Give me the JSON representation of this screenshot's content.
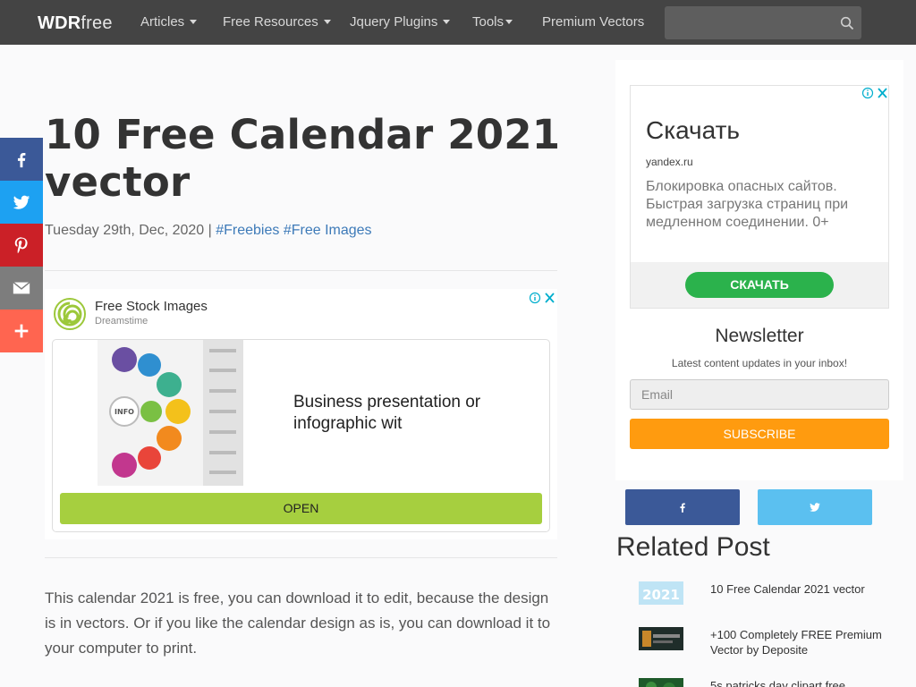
{
  "nav": {
    "logo_bold": "WDR",
    "logo_light": "free",
    "items": [
      {
        "label": "Articles"
      },
      {
        "label": "Free Resources"
      },
      {
        "label": "Jquery Plugins"
      },
      {
        "label": "Tools"
      },
      {
        "label": "Premium Vectors"
      }
    ],
    "search_placeholder": ""
  },
  "share_bar": [
    {
      "icon": "facebook-icon",
      "color": "#3b5998"
    },
    {
      "icon": "twitter-icon",
      "color": "#1da1f2"
    },
    {
      "icon": "pinterest-icon",
      "color": "#cb2027"
    },
    {
      "icon": "email-icon",
      "color": "#7d7d7d"
    },
    {
      "icon": "plus-icon",
      "color": "#ff6550"
    }
  ],
  "article": {
    "title": "10 Free Calendar 2021 vector",
    "date": "Tuesday 29th, Dec, 2020",
    "separator": " | ",
    "tags": [
      "#Freebies",
      "#Free Images"
    ],
    "body": "This calendar 2021 is free, you can download it to edit, because the design is in vectors. Or if you like the calendar design as is, you can download it to your computer to print."
  },
  "ad_main": {
    "advertiser": "Free Stock Images",
    "sub": "Dreamstime",
    "text": "Business presentation or infographic wit",
    "button": "OPEN",
    "image_label": "INFO"
  },
  "ad_side": {
    "headline": "Скачать",
    "domain": "yandex.ru",
    "description": "Блокировка опасных сайтов. Быстрая загрузка страниц при медленном соединении. 0+",
    "button": "СКАЧАТЬ"
  },
  "newsletter": {
    "title": "Newsletter",
    "subtitle": "Latest content updates in your inbox!",
    "email_placeholder": "Email",
    "button": "SUBSCRIBE"
  },
  "social_follow": [
    {
      "icon": "facebook-icon",
      "color": "#3b5998"
    },
    {
      "icon": "twitter-icon",
      "color": "#5bc0f0"
    }
  ],
  "related": {
    "title": "Related Post",
    "items": [
      {
        "text": "10 Free Calendar 2021 vector",
        "thumb_label": "2021"
      },
      {
        "text": "+100 Completely FREE Premium Vector by Deposite",
        "thumb_label": ""
      },
      {
        "text": "5s patricks day clipart free",
        "thumb_label": ""
      }
    ]
  },
  "colors": {
    "topbar": "#444444",
    "link": "#3d7ab8",
    "subscribe": "#ff9b0f",
    "open_button": "#a6cf3f",
    "download_button": "#2bb24c"
  }
}
